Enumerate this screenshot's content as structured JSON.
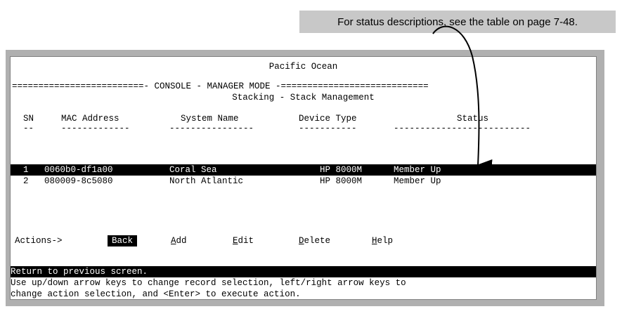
{
  "callout_text": "For status descriptions, see the table on page 7-48.",
  "terminal": {
    "system_name": "Pacific Ocean",
    "banner": "=========================- CONSOLE - MANAGER MODE -============================",
    "screen_title": "Stacking - Stack Management",
    "columns": [
      "SN",
      "MAC Address",
      "System Name",
      "Device Type",
      "Status"
    ],
    "underlines": [
      "--",
      "-------------",
      "----------------",
      "-----------",
      "--------------------------"
    ],
    "rows": [
      {
        "sn": "1",
        "mac": "0060b0-df1a00",
        "name": "Coral Sea",
        "type": "HP 8000M",
        "status": "Member Up"
      },
      {
        "sn": "2",
        "mac": "080009-8c5080",
        "name": "North Atlantic",
        "type": "HP 8000M",
        "status": "Member Up"
      }
    ],
    "actions_label": "Actions->",
    "actions": [
      {
        "label": "Back",
        "hotkey": "",
        "rest": "Back"
      },
      {
        "label": "Add",
        "hotkey": "A",
        "rest": "dd"
      },
      {
        "label": "Edit",
        "hotkey": "E",
        "rest": "dit"
      },
      {
        "label": "Delete",
        "hotkey": "D",
        "rest": "elete"
      },
      {
        "label": "Help",
        "hotkey": "H",
        "rest": "elp"
      }
    ],
    "status_line": "Return to previous screen.",
    "help_line_1": "Use up/down arrow keys to change record selection, left/right arrow keys to",
    "help_line_2": "change action selection, and <Enter> to execute action."
  }
}
